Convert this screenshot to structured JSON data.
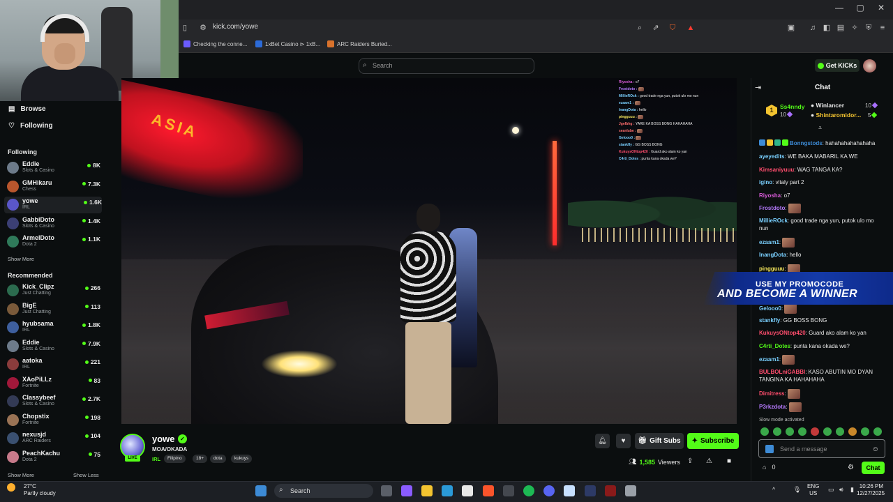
{
  "browser": {
    "url": "kick.com/yowe",
    "bookmarks": [
      "Checking the conne...",
      "1xBet Casino ⊳ 1xB...",
      "ARC Raiders Buried..."
    ]
  },
  "header": {
    "search_placeholder": "Search",
    "get_kicks": "Get KICKs"
  },
  "sidebar": {
    "nav": [
      "Browse",
      "Following"
    ],
    "following_title": "Following",
    "following": [
      {
        "name": "Eddie",
        "category": "Slots & Casino",
        "viewers": "8K",
        "color": "#6d7b8a"
      },
      {
        "name": "GMHikaru",
        "category": "Chess",
        "viewers": "7.3K",
        "color": "#b9562d"
      },
      {
        "name": "yowe",
        "category": "IRL",
        "viewers": "1.6K",
        "color": "#5a56c9"
      },
      {
        "name": "GabbiDoto",
        "category": "Slots & Casino",
        "viewers": "1.4K",
        "color": "#3b3f74"
      },
      {
        "name": "ArmelDoto",
        "category": "Dota 2",
        "viewers": "1.1K",
        "color": "#2f7a5a"
      }
    ],
    "show_more_1": "Show More",
    "recommended_title": "Recommended",
    "recommended": [
      {
        "name": "Kick_Clipz",
        "category": "Just Chatting",
        "viewers": "266",
        "color": "#2b6b4e"
      },
      {
        "name": "BigE",
        "category": "Just Chatting",
        "viewers": "113",
        "color": "#7a5a3a"
      },
      {
        "name": "hyubsama",
        "category": "IRL",
        "viewers": "1.8K",
        "color": "#3e5f9e"
      },
      {
        "name": "Eddie",
        "category": "Slots & Casino",
        "viewers": "7.9K",
        "color": "#6d7b8a"
      },
      {
        "name": "aatoka",
        "category": "IRL",
        "viewers": "221",
        "color": "#8a3c3c"
      },
      {
        "name": "XAoPiLLz",
        "category": "Fortnite",
        "viewers": "83",
        "color": "#a0183a"
      },
      {
        "name": "Classybeef",
        "category": "Slots & Casino",
        "viewers": "2.7K",
        "color": "#333a55"
      },
      {
        "name": "Chopstix",
        "category": "Fortnite",
        "viewers": "198",
        "color": "#9a7355"
      },
      {
        "name": "nexusjd",
        "category": "ARC Raiders",
        "viewers": "104",
        "color": "#3a5070"
      },
      {
        "name": "PeachKachu",
        "category": "Dota 2",
        "viewers": "75",
        "color": "#c77a8a"
      }
    ],
    "show_more_2": "Show More",
    "show_less": "Show Less"
  },
  "stream": {
    "name": "yowe",
    "live": "LIVE",
    "title": "MOA/OKADA",
    "category": "IRL",
    "tags": [
      "Filipino",
      "18+",
      "dota",
      "kukuys"
    ],
    "gift_subs": "Gift Subs",
    "subscribe": "Subscribe",
    "viewers": "1,585",
    "viewers_label": "Viewers",
    "overlay_chat": [
      {
        "user": "Riyosha",
        "text": "o7",
        "color": "#d95bd8"
      },
      {
        "user": "Frostdoto",
        "text": "",
        "color": "#b77bff"
      },
      {
        "user": "MillieROck",
        "text": "good trade nga yun, putok ulo mo nun",
        "color": "#7ad0ff"
      },
      {
        "user": "ezaam1",
        "text": "",
        "color": "#7ad0ff"
      },
      {
        "user": "InangDota",
        "text": "hello",
        "color": "#7ad0ff"
      },
      {
        "user": "pingguuu",
        "text": "",
        "color": "#f1e35a"
      },
      {
        "user": "Jgefbhg",
        "text": "YARE KA BOSS BONG HAHAHAHA",
        "color": "#ff6d6d"
      },
      {
        "user": "seanlube",
        "text": "",
        "color": "#ff6d6d"
      },
      {
        "user": "Gelooo0",
        "text": "",
        "color": "#7ad0ff"
      },
      {
        "user": "stankfly",
        "text": "GG BOSS BONG",
        "color": "#7ad0ff"
      },
      {
        "user": "KukuysONtop420",
        "text": "Guard ako alam ko yan",
        "color": "#ff4d6d"
      },
      {
        "user": "C4rti_Dotes",
        "text": "punta kana okada we?",
        "color": "#7ad0ff"
      }
    ],
    "video_sign": "ASIA"
  },
  "chat": {
    "title": "Chat",
    "leaderboard": [
      {
        "name": "Ss4nndy",
        "count": "10",
        "color": "#53fc18"
      },
      {
        "name": "Winlancer",
        "count": "10",
        "color": "#ffffff"
      },
      {
        "name": "Shintaromidor...",
        "count": "5",
        "color": "#f4c430"
      }
    ],
    "rank": "1",
    "messages": [
      {
        "user": "Bonngstods",
        "text": "hahahahahahahaha",
        "color": "#3d8bd6"
      },
      {
        "user": "ayeyedits",
        "text": "WE BAKA MABARIL KA WE",
        "color": "#7ad0ff"
      },
      {
        "user": "Kimsaniyuuu",
        "text": "WAG TANGA KA?",
        "color": "#ff4d6d"
      },
      {
        "user": "igino",
        "text": "vitaly part 2",
        "color": "#7ad0ff"
      },
      {
        "user": "Riyosha",
        "text": "o7",
        "color": "#d95bd8"
      },
      {
        "user": "Frostdoto",
        "text": "",
        "color": "#b77bff"
      },
      {
        "user": "MillieROck",
        "text": "good trade nga yun, putok ulo mo nun",
        "color": "#7ad0ff"
      },
      {
        "user": "ezaam1",
        "text": "",
        "color": "#7ad0ff"
      },
      {
        "user": "InangDota",
        "text": "hello",
        "color": "#7ad0ff"
      },
      {
        "user": "pingguuu",
        "text": "",
        "color": "#f1e35a"
      },
      {
        "user": "Gelooo0",
        "text": "",
        "color": "#7ad0ff"
      },
      {
        "user": "stankfly",
        "text": "GG BOSS BONG",
        "color": "#7ad0ff"
      },
      {
        "user": "KukuysONtop420",
        "text": "Guard ako alam ko yan",
        "color": "#ff4d6d"
      },
      {
        "user": "C4rti_Dotes",
        "text": "punta kana okada we?",
        "color": "#53fc18"
      },
      {
        "user": "ezaam1",
        "text": "",
        "color": "#7ad0ff"
      },
      {
        "user": "BULBOLniGABBI",
        "text": "KASO ABUTIN MO DYAN TANGINA KA HAHAHAHA",
        "color": "#ff4d6d"
      },
      {
        "user": "Dimitress",
        "text": "",
        "color": "#ff4d6d"
      },
      {
        "user": "P3rkzdota",
        "text": "",
        "color": "#b77bff"
      }
    ],
    "promo_line1": "USE MY PROMOCODE",
    "promo_line2": "AND BECOME A WINNER",
    "slow_mode": "Slow mode activated",
    "input_placeholder": "Send a message",
    "kicks_balance": "0",
    "send": "Chat"
  },
  "taskbar": {
    "temp": "27°C",
    "weather": "Partly cloudy",
    "search": "Search",
    "lang": "ENG",
    "region": "US",
    "time": "10:26 PM",
    "date": "12/27/2025"
  }
}
